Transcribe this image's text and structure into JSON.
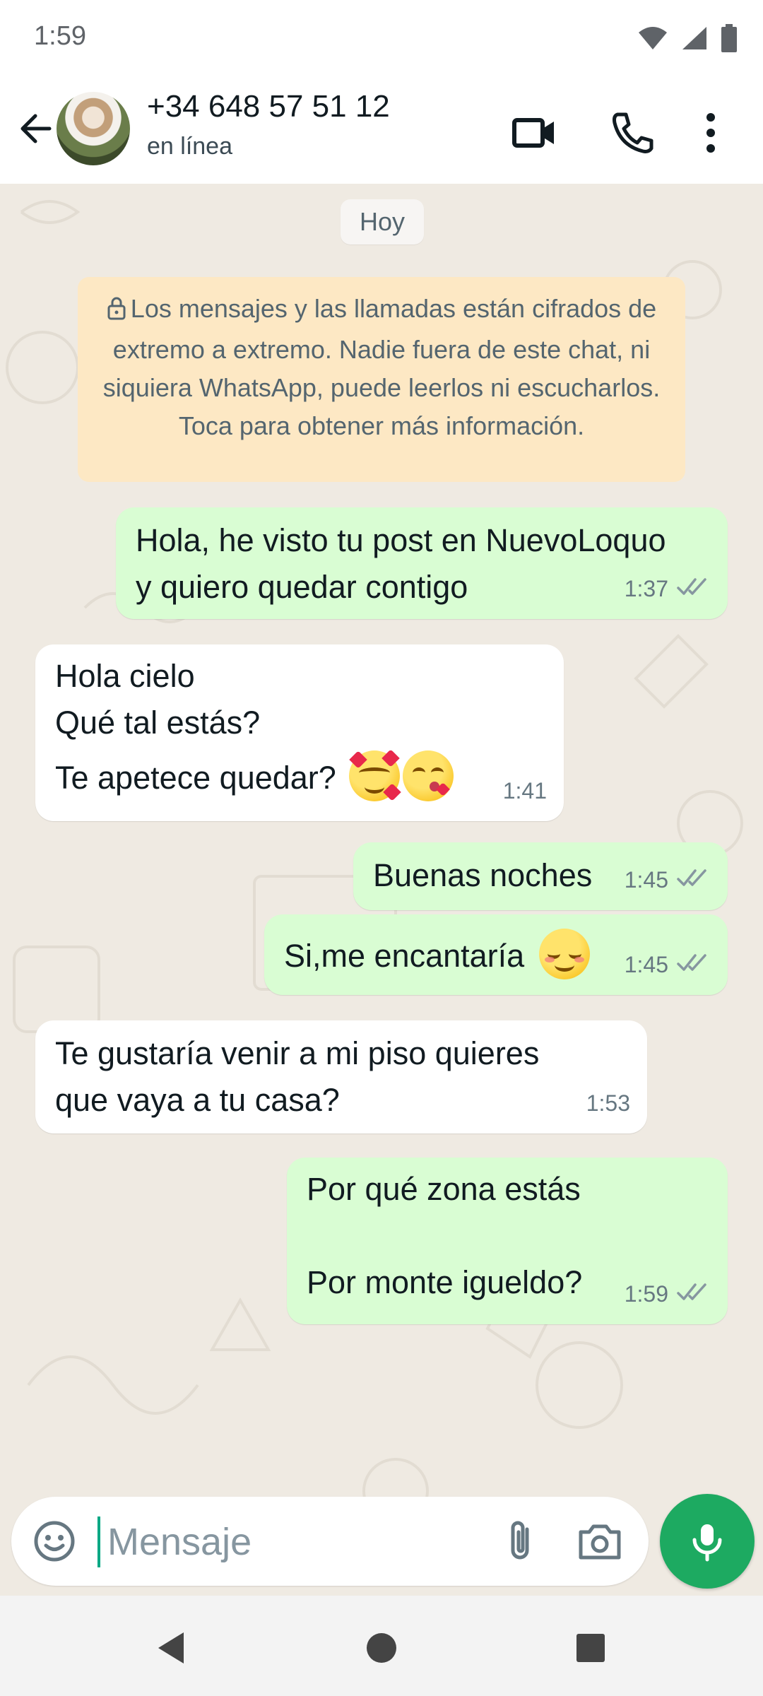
{
  "status_bar": {
    "time": "1:59",
    "icons": [
      "wifi-icon",
      "signal-icon",
      "battery-icon"
    ]
  },
  "header": {
    "back_icon": "arrow-left-icon",
    "contact_name": "+34 648 57 51 12",
    "contact_status": "en línea",
    "actions": [
      "video-call-icon",
      "voice-call-icon",
      "more-vertical-icon"
    ]
  },
  "chat": {
    "date_chip": "Hoy",
    "encryption_notice": "Los mensajes y las llamadas están cifrados de extremo a extremo. Nadie fuera de este chat, ni siquiera WhatsApp, puede leerlos ni escucharlos. Toca para obtener más información.",
    "messages": [
      {
        "direction": "out",
        "text": "Hola, he visto tu post en NuevoLoquo\ny quiero quedar contigo",
        "time": "1:37",
        "status": "read"
      },
      {
        "direction": "in",
        "text_line1": "Hola cielo",
        "text_line2": "Qué tal estás?",
        "text_line3": "Te apetece quedar?",
        "emojis": [
          "smiling-face-with-hearts",
          "face-blowing-kiss"
        ],
        "time": "1:41"
      },
      {
        "direction": "out",
        "text": "Buenas noches",
        "time": "1:45",
        "status": "read"
      },
      {
        "direction": "out",
        "text": "Si,me encantaría",
        "emojis": [
          "relieved-face"
        ],
        "time": "1:45",
        "status": "read"
      },
      {
        "direction": "in",
        "text": "Te gustaría venir a mi piso quieres\nque vaya a tu casa?",
        "time": "1:53"
      },
      {
        "direction": "out",
        "text": "Por qué zona estás\n\nPor monte igueldo?",
        "time": "1:59",
        "status": "read"
      }
    ]
  },
  "composer": {
    "placeholder": "Mensaje",
    "value": "",
    "icons": [
      "emoji-icon",
      "attach-icon",
      "camera-icon",
      "microphone-icon"
    ]
  },
  "colors": {
    "chat_background": "#efeae2",
    "outgoing_bubble": "#d9fdd3",
    "incoming_bubble": "#ffffff",
    "encryption_notice": "#fde8c4",
    "accent": "#1daa61",
    "read_ticks": "#8696a0"
  },
  "nav_bar": {
    "buttons": [
      "back-triangle-icon",
      "home-circle-icon",
      "recents-square-icon"
    ]
  }
}
